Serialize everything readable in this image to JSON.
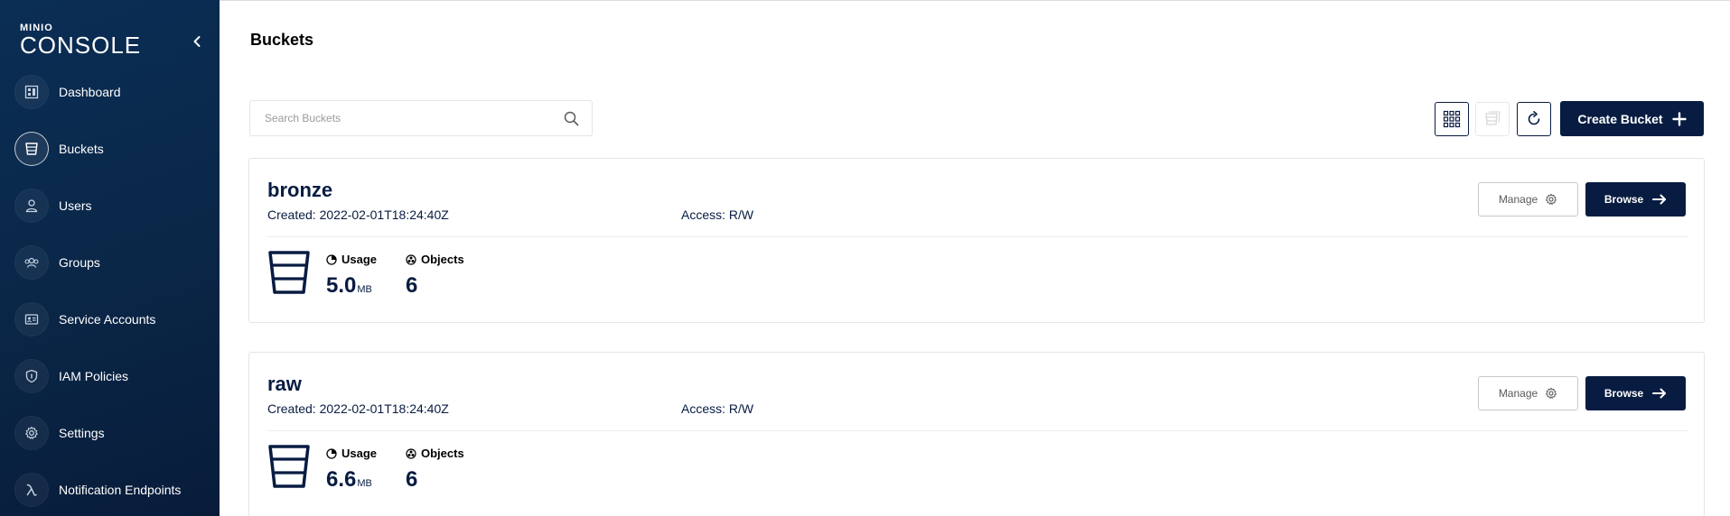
{
  "sidebar": {
    "logo_small": "MINIO",
    "logo_big": "CONSOLE",
    "items": [
      {
        "label": "Dashboard",
        "icon": "dashboard-icon"
      },
      {
        "label": "Buckets",
        "icon": "bucket-icon",
        "active": true
      },
      {
        "label": "Users",
        "icon": "user-icon"
      },
      {
        "label": "Groups",
        "icon": "groups-icon"
      },
      {
        "label": "Service Accounts",
        "icon": "id-card-icon"
      },
      {
        "label": "IAM Policies",
        "icon": "shield-icon"
      },
      {
        "label": "Settings",
        "icon": "gear-icon"
      },
      {
        "label": "Notification Endpoints",
        "icon": "lambda-icon"
      }
    ]
  },
  "header": {
    "title": "Buckets"
  },
  "toolbar": {
    "search_placeholder": "Search Buckets",
    "create_label": "Create Bucket"
  },
  "buckets": [
    {
      "name": "bronze",
      "created": "Created: 2022-02-01T18:24:40Z",
      "access": "Access: R/W",
      "manage_label": "Manage",
      "browse_label": "Browse",
      "usage_label": "Usage",
      "usage_value": "5.0",
      "usage_unit": "MB",
      "objects_label": "Objects",
      "objects_value": "6"
    },
    {
      "name": "raw",
      "created": "Created: 2022-02-01T18:24:40Z",
      "access": "Access: R/W",
      "manage_label": "Manage",
      "browse_label": "Browse",
      "usage_label": "Usage",
      "usage_value": "6.6",
      "usage_unit": "MB",
      "objects_label": "Objects",
      "objects_value": "6"
    }
  ],
  "colors": {
    "primary": "#081c42",
    "sidebar": "#0a2748"
  }
}
